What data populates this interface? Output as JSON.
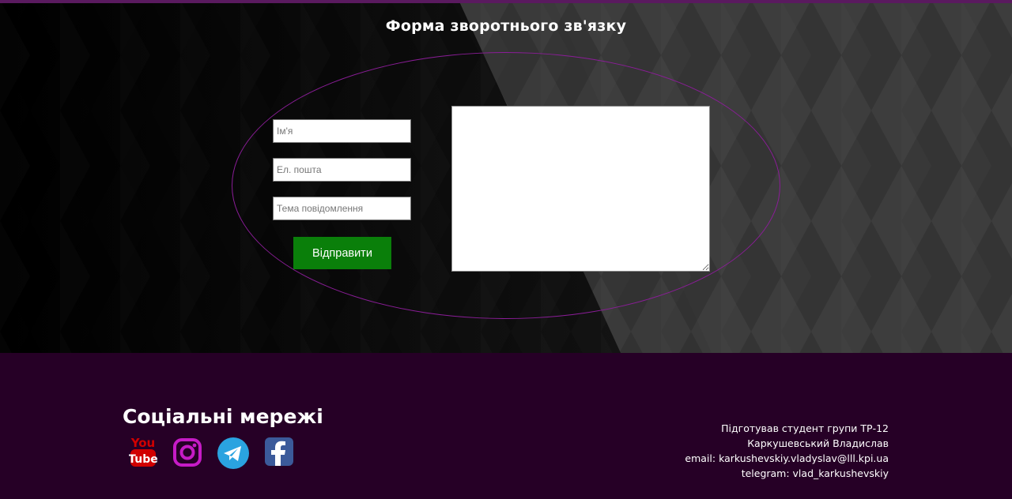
{
  "form": {
    "title": "Форма зворотнього зв'язку",
    "name_placeholder": "Ім'я",
    "email_placeholder": "Ел. пошта",
    "subject_placeholder": "Тема повідомлення",
    "message_value": "",
    "submit_label": "Відправити"
  },
  "footer": {
    "social_title": "Соціальні мережі",
    "social_icons": [
      "youtube-icon",
      "instagram-icon",
      "telegram-icon",
      "facebook-icon"
    ],
    "credits": {
      "line1": "Підготував студент групи ТР-12",
      "line2": "Каркушевський Владислав",
      "line3": "email: karkushevskiy.vladyslav@lll.kpi.ua",
      "line4": "telegram: vlad_karkushevskiy"
    }
  },
  "colors": {
    "accent_purple": "#8a1d97",
    "footer_bg": "#260026",
    "button_green": "#0a7f0a"
  }
}
